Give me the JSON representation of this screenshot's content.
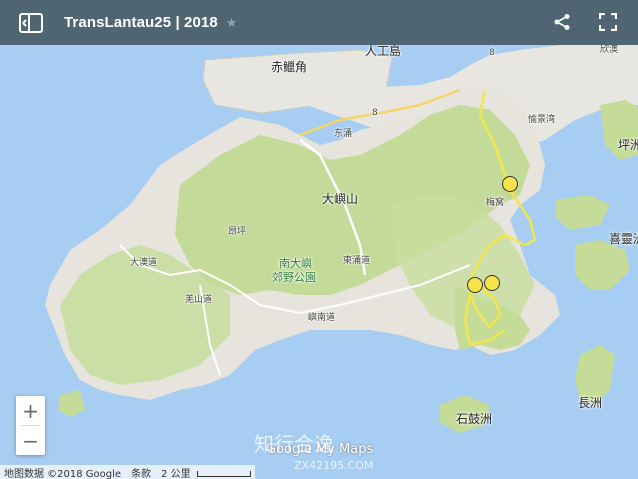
{
  "header": {
    "title": "TransLantau25 | 2018",
    "star_icon": "star-icon",
    "share_icon": "share-icon",
    "fullscreen_icon": "fullscreen-icon",
    "sidebar_icon": "sidebar-toggle-icon"
  },
  "map": {
    "labels": {
      "chek_lap_kok": "赤鱲角",
      "artificial_island": "人工島",
      "tung_chung": "东涌",
      "tai_yue_shan": "大嶼山",
      "ngong_ping": "昂坪",
      "south_lantau_park": "南大嶼",
      "south_lantau_park_2": "郊野公園",
      "mui_wo": "梅窝",
      "siu_ho_wan": "欣澳",
      "discovery_bay_like": "愉景湾",
      "ping_chau": "坪洲",
      "hei_ling_chau": "喜靈洲",
      "cheung_chau": "長洲",
      "shek_kwu_chau": "石鼓洲",
      "road_8_a": "8",
      "road_8_b": "8",
      "road_tung_chung": "東涌道",
      "road_south_lantau": "嶼南道",
      "road_keung_shan": "羌山道",
      "road_tai_o": "大澳道",
      "lung_kwu": "東灣",
      "tung_cheung_label": "東涌道"
    },
    "colors": {
      "water": "#a7cdf2",
      "land": "#e8e6e0",
      "park": "#bcd88c",
      "route": "#f1e64a",
      "header": "#4f6672"
    }
  },
  "zoom": {
    "plus": "+",
    "minus": "−"
  },
  "footer": {
    "map_data": "地图数据 ©2018 Google",
    "terms": "条款",
    "scale": "2 公里"
  },
  "logo": {
    "text": "Google My Maps"
  },
  "watermark": {
    "text": "知行合逸",
    "sub": "ZX42195.COM"
  }
}
